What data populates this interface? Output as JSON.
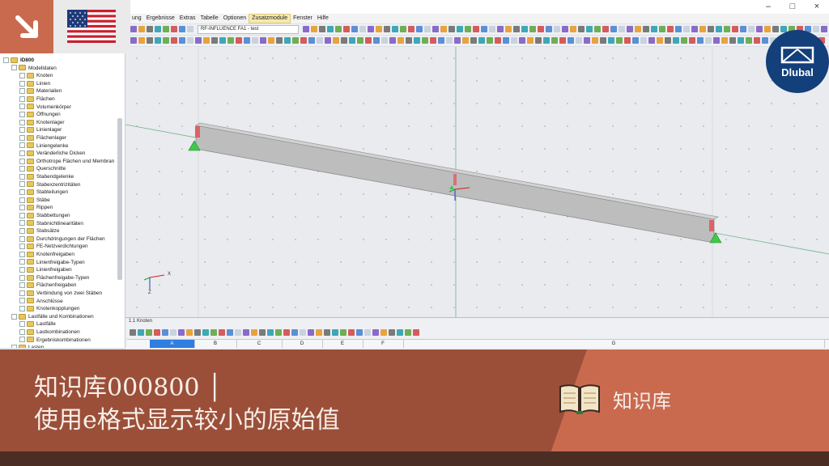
{
  "window": {
    "min_glyph": "–",
    "max_glyph": "□",
    "close_glyph": "×"
  },
  "menu": {
    "items": [
      "ung",
      "Ergebnisse",
      "Extras",
      "Tabelle",
      "Optionen",
      "Zusatzmodule",
      "Fenster",
      "Hilfe"
    ],
    "active_index": 5
  },
  "toolbar": {
    "combo_value": "RF-INFLUENCE FA1 - test"
  },
  "navigator": {
    "items": [
      {
        "label": "ID800",
        "level": 0,
        "bold": true
      },
      {
        "label": "Modelldaten",
        "level": 1
      },
      {
        "label": "Knoten",
        "level": 2
      },
      {
        "label": "Linien",
        "level": 2
      },
      {
        "label": "Materialien",
        "level": 2
      },
      {
        "label": "Flächen",
        "level": 2
      },
      {
        "label": "Volumenkörper",
        "level": 2
      },
      {
        "label": "Öffnungen",
        "level": 2
      },
      {
        "label": "Knotenlager",
        "level": 2
      },
      {
        "label": "Linienlager",
        "level": 2
      },
      {
        "label": "Flächenlager",
        "level": 2
      },
      {
        "label": "Liniengelenke",
        "level": 2
      },
      {
        "label": "Veränderliche Dicken",
        "level": 2
      },
      {
        "label": "Orthotrope Flächen und Membran",
        "level": 2
      },
      {
        "label": "Querschnitte",
        "level": 2
      },
      {
        "label": "Stabendgelenke",
        "level": 2
      },
      {
        "label": "Stabexzentrizitäten",
        "level": 2
      },
      {
        "label": "Stabteilungen",
        "level": 2
      },
      {
        "label": "Stäbe",
        "level": 2
      },
      {
        "label": "Rippen",
        "level": 2
      },
      {
        "label": "Stabbettungen",
        "level": 2
      },
      {
        "label": "Stabnichtlinearitäten",
        "level": 2
      },
      {
        "label": "Stabsätze",
        "level": 2
      },
      {
        "label": "Durchdringungen der Flächen",
        "level": 2
      },
      {
        "label": "FE-Netzverdichtungen",
        "level": 2
      },
      {
        "label": "Knotenfreigaben",
        "level": 2
      },
      {
        "label": "Linienfreigabe-Typen",
        "level": 2
      },
      {
        "label": "Linienfreigaben",
        "level": 2
      },
      {
        "label": "Flächenfreigabe-Typen",
        "level": 2
      },
      {
        "label": "Flächenfreigaben",
        "level": 2
      },
      {
        "label": "Verbindung von zwei Stäben",
        "level": 2
      },
      {
        "label": "Anschlüsse",
        "level": 2
      },
      {
        "label": "Knotenkopplungen",
        "level": 2
      },
      {
        "label": "Lastfälle und Kombinationen",
        "level": 1
      },
      {
        "label": "Lastfälle",
        "level": 2
      },
      {
        "label": "Lastkombinationen",
        "level": 2
      },
      {
        "label": "Ergebniskombinationen",
        "level": 2
      },
      {
        "label": "Lasten",
        "level": 1
      }
    ]
  },
  "viewport": {
    "axis_x_label": "X",
    "axis_z_label": "Z"
  },
  "table": {
    "title": "1.1 Knoten",
    "columns": [
      "A",
      "B",
      "C",
      "D",
      "E",
      "F",
      "G"
    ],
    "selected_column": "A"
  },
  "header": {
    "logo_text": "Dlubal"
  },
  "banner": {
    "line1": "知识库000800 │",
    "line2": "使用e格式显示较小的原始值",
    "kb_label": "知识库"
  },
  "colors": {
    "banner": "#9b4f39",
    "banner_accent": "#c96a4f",
    "logo_blue": "#133f7a",
    "support_green": "#3ec94a",
    "axis_red": "#d32020"
  }
}
